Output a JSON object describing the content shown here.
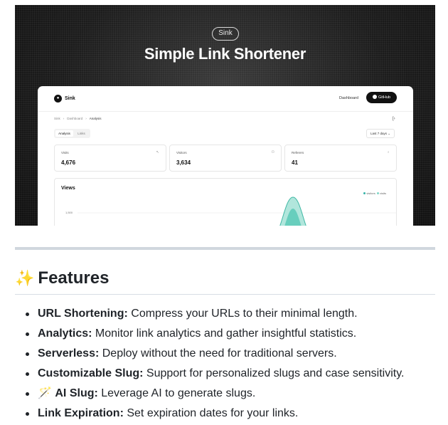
{
  "hero": {
    "badge": "Sink",
    "title": "Simple Link Shortener"
  },
  "app": {
    "logo": "Sink",
    "nav": {
      "dashboard": "Dashboard",
      "github": "GitHub"
    },
    "breadcrumb": [
      "Sink",
      "Dashboard",
      "Analysis"
    ],
    "tabs": [
      {
        "label": "Analysis",
        "active": true
      },
      {
        "label": "Links",
        "active": false
      }
    ],
    "range": "Last 7 days",
    "stats": [
      {
        "label": "Visits",
        "value": "4,676",
        "icon": "pointer-icon"
      },
      {
        "label": "Visitors",
        "value": "3,634",
        "icon": "users-icon"
      },
      {
        "label": "Referers",
        "value": "41",
        "icon": "flame-icon"
      }
    ],
    "views": {
      "title": "Views",
      "y_tick": "1,500",
      "legend": [
        {
          "name": "visitors",
          "color": "#36b3a8"
        },
        {
          "name": "visits",
          "color": "#7fd6c7"
        }
      ]
    }
  },
  "features": {
    "heading": "Features",
    "heading_icon": "✨",
    "items": [
      {
        "name": "URL Shortening:",
        "desc": " Compress your URLs to their minimal length.",
        "icon": ""
      },
      {
        "name": "Analytics:",
        "desc": " Monitor link analytics and gather insightful statistics.",
        "icon": ""
      },
      {
        "name": "Serverless:",
        "desc": " Deploy without the need for traditional servers.",
        "icon": ""
      },
      {
        "name": "Customizable Slug:",
        "desc": " Support for personalized slugs and case sensitivity.",
        "icon": ""
      },
      {
        "name": "AI Slug:",
        "desc": " Leverage AI to generate slugs.",
        "icon": "🪄"
      },
      {
        "name": "Link Expiration:",
        "desc": " Set expiration dates for your links.",
        "icon": ""
      }
    ]
  },
  "colors": {
    "chart_fill_outer": "#a8e3d8",
    "chart_fill_inner": "#5cc9b7",
    "divider": "#d0d7de"
  }
}
